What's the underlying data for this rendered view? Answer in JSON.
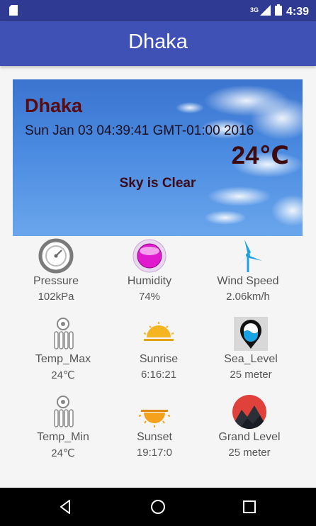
{
  "status_bar": {
    "time": "4:39",
    "network": "3G"
  },
  "app_bar": {
    "title": "Dhaka"
  },
  "weather": {
    "city": "Dhaka",
    "datetime": "Sun Jan 03 04:39:41 GMT-01:00 2016",
    "temperature": "24℃",
    "condition": "Sky is Clear"
  },
  "details": [
    {
      "label": "Pressure",
      "value": "102kPa",
      "icon": "pressure-gauge-icon"
    },
    {
      "label": "Humidity",
      "value": "74%",
      "icon": "humidity-icon"
    },
    {
      "label": "Wind Speed",
      "value": "2.06km/h",
      "icon": "wind-turbine-icon"
    },
    {
      "label": "Temp_Max",
      "value": "24℃",
      "icon": "thermometer-icon"
    },
    {
      "label": "Sunrise",
      "value": "6:16:21",
      "icon": "sunrise-icon"
    },
    {
      "label": "Sea_Level",
      "value": "25 meter",
      "icon": "sea-level-icon"
    },
    {
      "label": "Temp_Min",
      "value": "24℃",
      "icon": "thermometer-icon"
    },
    {
      "label": "Sunset",
      "value": "19:17:0",
      "icon": "sunset-icon"
    },
    {
      "label": "Grand Level",
      "value": "25 meter",
      "icon": "mountain-icon"
    }
  ],
  "colors": {
    "status_bar": "#2f3b92",
    "app_bar": "#3f51b5",
    "city_text": "#5a0b10",
    "label_text": "#555555"
  }
}
